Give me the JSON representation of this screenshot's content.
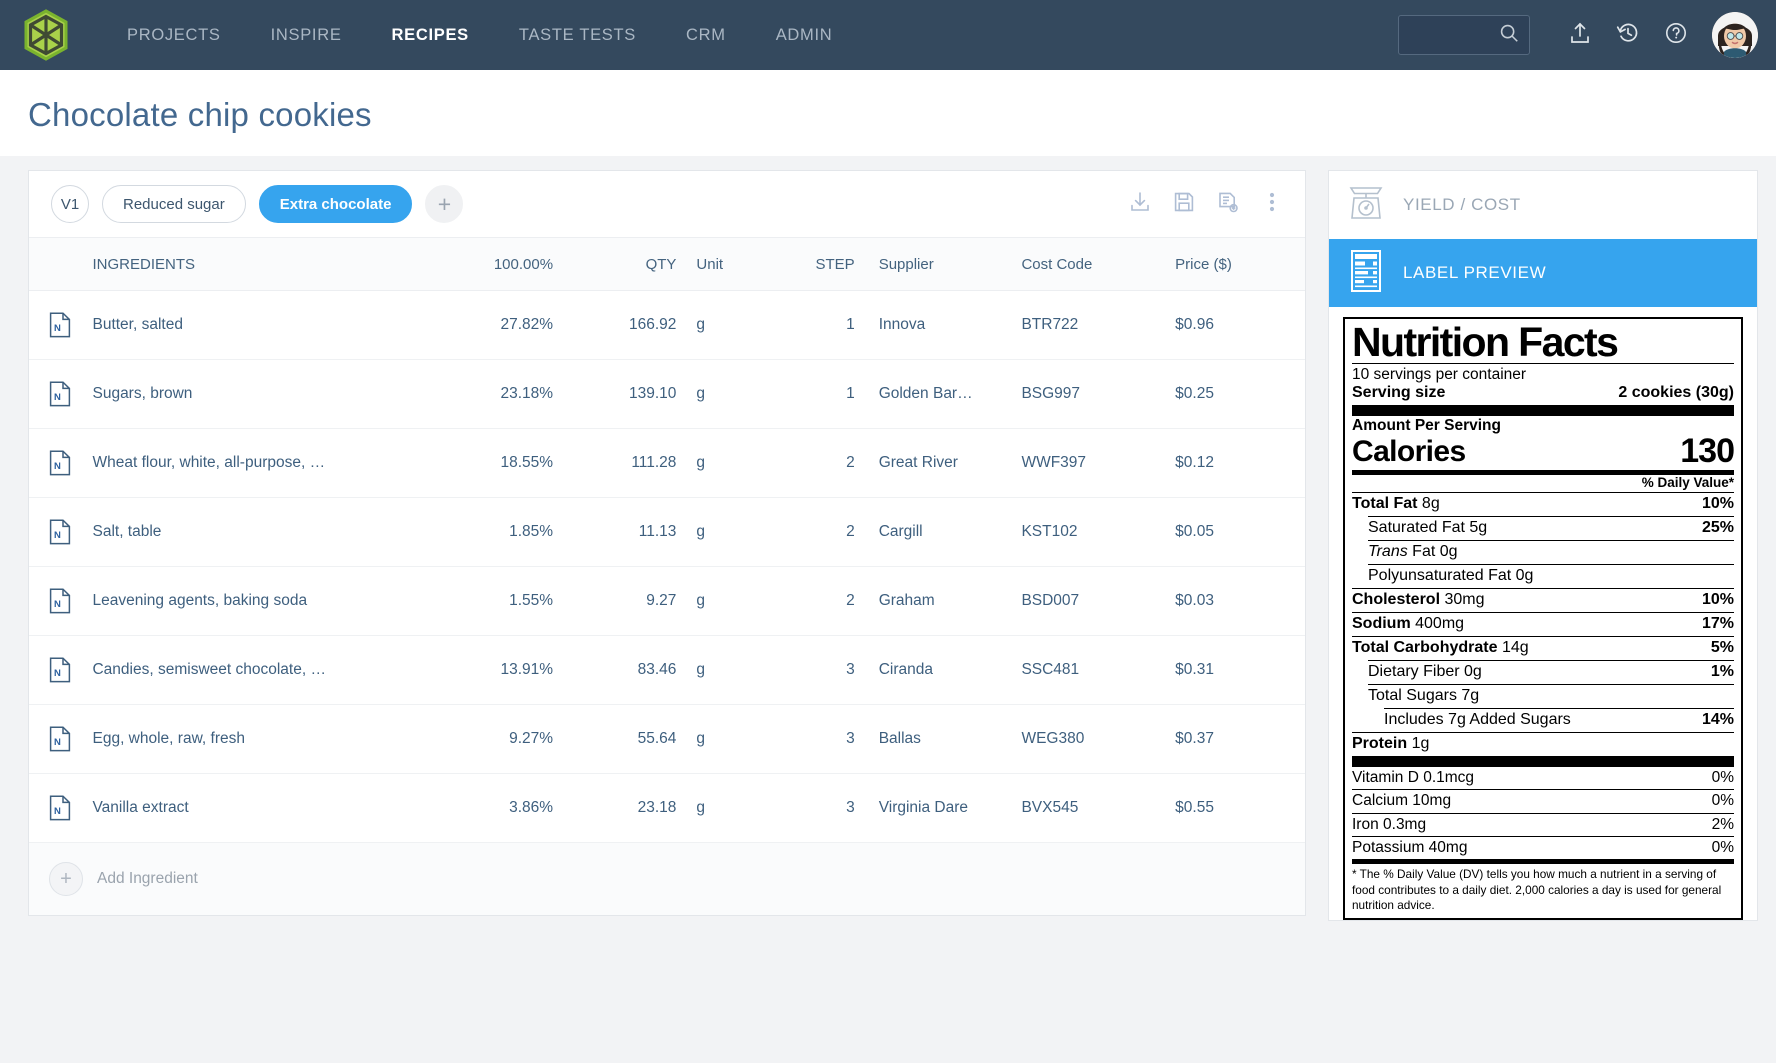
{
  "brand": {
    "logo_icon": "hexagon-spokes-logo",
    "accent": "#36a4ee",
    "nav_bg": "#34495e"
  },
  "nav": {
    "items": [
      {
        "label": "PROJECTS",
        "active": false
      },
      {
        "label": "INSPIRE",
        "active": false
      },
      {
        "label": "RECIPES",
        "active": true
      },
      {
        "label": "TASTE TESTS",
        "active": false
      },
      {
        "label": "CRM",
        "active": false
      },
      {
        "label": "ADMIN",
        "active": false
      }
    ],
    "search": {
      "value": "",
      "placeholder": "",
      "icon": "search-icon"
    },
    "actions": [
      {
        "icon": "upload-icon",
        "label": "Upload"
      },
      {
        "icon": "history-icon",
        "label": "History"
      },
      {
        "icon": "help-icon",
        "label": "Help"
      }
    ],
    "avatar": {
      "icon": "user-avatar"
    }
  },
  "page": {
    "title": "Chocolate chip cookies"
  },
  "versions": {
    "tabs": [
      {
        "label": "V1",
        "active": false,
        "shape": "circle"
      },
      {
        "label": "Reduced sugar",
        "active": false,
        "shape": "pill"
      },
      {
        "label": "Extra chocolate",
        "active": true,
        "shape": "pill"
      }
    ],
    "add_label": "+",
    "toolbar": [
      {
        "icon": "download-icon",
        "label": "Download"
      },
      {
        "icon": "save-icon",
        "label": "Save"
      },
      {
        "icon": "save-as-icon",
        "label": "Save as new"
      },
      {
        "icon": "more-vertical-icon",
        "label": "More options"
      }
    ]
  },
  "table": {
    "columns": [
      "INGREDIENTS",
      "100.00%",
      "QTY",
      "Unit",
      "STEP",
      "Supplier",
      "Cost Code",
      "Price ($)"
    ],
    "rows": [
      {
        "icon": "nutrition-doc-icon",
        "name": "Butter, salted",
        "pct": "27.82%",
        "qty": "166.92",
        "unit": "g",
        "step": "1",
        "supplier": "Innova",
        "cost_code": "BTR722",
        "price": "$0.96"
      },
      {
        "icon": "nutrition-doc-icon",
        "name": "Sugars, brown",
        "pct": "23.18%",
        "qty": "139.10",
        "unit": "g",
        "step": "1",
        "supplier": "Golden Bar…",
        "cost_code": "BSG997",
        "price": "$0.25"
      },
      {
        "icon": "nutrition-doc-icon",
        "name": "Wheat flour, white, all-purpose, …",
        "pct": "18.55%",
        "qty": "111.28",
        "unit": "g",
        "step": "2",
        "supplier": "Great River",
        "cost_code": "WWF397",
        "price": "$0.12"
      },
      {
        "icon": "nutrition-doc-icon",
        "name": "Salt, table",
        "pct": "1.85%",
        "qty": "11.13",
        "unit": "g",
        "step": "2",
        "supplier": "Cargill",
        "cost_code": "KST102",
        "price": "$0.05"
      },
      {
        "icon": "nutrition-doc-icon",
        "name": "Leavening agents, baking soda",
        "pct": "1.55%",
        "qty": "9.27",
        "unit": "g",
        "step": "2",
        "supplier": "Graham",
        "cost_code": "BSD007",
        "price": "$0.03"
      },
      {
        "icon": "nutrition-doc-icon",
        "name": "Candies, semisweet chocolate, …",
        "pct": "13.91%",
        "qty": "83.46",
        "unit": "g",
        "step": "3",
        "supplier": "Ciranda",
        "cost_code": "SSC481",
        "price": "$0.31"
      },
      {
        "icon": "nutrition-doc-icon",
        "name": "Egg, whole, raw, fresh",
        "pct": "9.27%",
        "qty": "55.64",
        "unit": "g",
        "step": "3",
        "supplier": "Ballas",
        "cost_code": "WEG380",
        "price": "$0.37"
      },
      {
        "icon": "nutrition-doc-icon",
        "name": "Vanilla extract",
        "pct": "3.86%",
        "qty": "23.18",
        "unit": "g",
        "step": "3",
        "supplier": "Virginia Dare",
        "cost_code": "BVX545",
        "price": "$0.55"
      }
    ],
    "add_ingredient_label": "Add Ingredient"
  },
  "right_panel": {
    "tabs": [
      {
        "label": "YIELD / COST",
        "icon": "kitchen-scale-icon",
        "active": false
      },
      {
        "label": "LABEL PREVIEW",
        "icon": "nutrition-label-icon",
        "active": true
      }
    ]
  },
  "nutrition_facts": {
    "title": "Nutrition Facts",
    "servings_per_container": "10 servings per container",
    "serving_size_label": "Serving size",
    "serving_size_value": "2 cookies (30g)",
    "amount_per_serving": "Amount Per Serving",
    "calories_label": "Calories",
    "calories_value": "130",
    "daily_value_header": "% Daily Value*",
    "nutrients": [
      {
        "name": "Total Fat",
        "amount": "8g",
        "dv": "10%",
        "bold": true,
        "indent": 0
      },
      {
        "name": "Saturated Fat",
        "amount": "5g",
        "dv": "25%",
        "bold": false,
        "indent": 1
      },
      {
        "name": "Trans Fat",
        "amount": "0g",
        "dv": "",
        "bold": false,
        "indent": 1,
        "italic_first": true
      },
      {
        "name": "Polyunsaturated Fat",
        "amount": "0g",
        "dv": "",
        "bold": false,
        "indent": 1
      },
      {
        "name": "Cholesterol",
        "amount": "30mg",
        "dv": "10%",
        "bold": true,
        "indent": 0
      },
      {
        "name": "Sodium",
        "amount": "400mg",
        "dv": "17%",
        "bold": true,
        "indent": 0
      },
      {
        "name": "Total Carbohydrate",
        "amount": "14g",
        "dv": "5%",
        "bold": true,
        "indent": 0
      },
      {
        "name": "Dietary Fiber",
        "amount": "0g",
        "dv": "1%",
        "bold": false,
        "indent": 1
      },
      {
        "name": "Total Sugars",
        "amount": "7g",
        "dv": "",
        "bold": false,
        "indent": 1
      },
      {
        "name": "Includes 7g Added Sugars",
        "amount": "",
        "dv": "14%",
        "bold": false,
        "indent": 2
      },
      {
        "name": "Protein",
        "amount": "1g",
        "dv": "",
        "bold": true,
        "indent": 0
      }
    ],
    "vitamins": [
      {
        "name": "Vitamin D 0.1mcg",
        "dv": "0%"
      },
      {
        "name": "Calcium 10mg",
        "dv": "0%"
      },
      {
        "name": "Iron 0.3mg",
        "dv": "2%"
      },
      {
        "name": "Potassium 40mg",
        "dv": "0%"
      }
    ],
    "footnote": "* The % Daily Value (DV) tells you how much a nutrient in a serving of food contributes to a daily diet. 2,000 calories a day is used for general nutrition advice."
  }
}
